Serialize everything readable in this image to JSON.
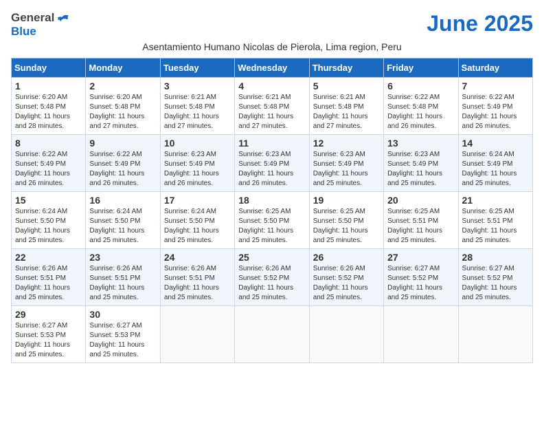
{
  "header": {
    "logo_general": "General",
    "logo_blue": "Blue",
    "month_title": "June 2025",
    "subtitle": "Asentamiento Humano Nicolas de Pierola, Lima region, Peru"
  },
  "weekdays": [
    "Sunday",
    "Monday",
    "Tuesday",
    "Wednesday",
    "Thursday",
    "Friday",
    "Saturday"
  ],
  "weeks": [
    [
      {
        "day": "1",
        "info": "Sunrise: 6:20 AM\nSunset: 5:48 PM\nDaylight: 11 hours\nand 28 minutes."
      },
      {
        "day": "2",
        "info": "Sunrise: 6:20 AM\nSunset: 5:48 PM\nDaylight: 11 hours\nand 27 minutes."
      },
      {
        "day": "3",
        "info": "Sunrise: 6:21 AM\nSunset: 5:48 PM\nDaylight: 11 hours\nand 27 minutes."
      },
      {
        "day": "4",
        "info": "Sunrise: 6:21 AM\nSunset: 5:48 PM\nDaylight: 11 hours\nand 27 minutes."
      },
      {
        "day": "5",
        "info": "Sunrise: 6:21 AM\nSunset: 5:48 PM\nDaylight: 11 hours\nand 27 minutes."
      },
      {
        "day": "6",
        "info": "Sunrise: 6:22 AM\nSunset: 5:48 PM\nDaylight: 11 hours\nand 26 minutes."
      },
      {
        "day": "7",
        "info": "Sunrise: 6:22 AM\nSunset: 5:49 PM\nDaylight: 11 hours\nand 26 minutes."
      }
    ],
    [
      {
        "day": "8",
        "info": "Sunrise: 6:22 AM\nSunset: 5:49 PM\nDaylight: 11 hours\nand 26 minutes."
      },
      {
        "day": "9",
        "info": "Sunrise: 6:22 AM\nSunset: 5:49 PM\nDaylight: 11 hours\nand 26 minutes."
      },
      {
        "day": "10",
        "info": "Sunrise: 6:23 AM\nSunset: 5:49 PM\nDaylight: 11 hours\nand 26 minutes."
      },
      {
        "day": "11",
        "info": "Sunrise: 6:23 AM\nSunset: 5:49 PM\nDaylight: 11 hours\nand 26 minutes."
      },
      {
        "day": "12",
        "info": "Sunrise: 6:23 AM\nSunset: 5:49 PM\nDaylight: 11 hours\nand 25 minutes."
      },
      {
        "day": "13",
        "info": "Sunrise: 6:23 AM\nSunset: 5:49 PM\nDaylight: 11 hours\nand 25 minutes."
      },
      {
        "day": "14",
        "info": "Sunrise: 6:24 AM\nSunset: 5:49 PM\nDaylight: 11 hours\nand 25 minutes."
      }
    ],
    [
      {
        "day": "15",
        "info": "Sunrise: 6:24 AM\nSunset: 5:50 PM\nDaylight: 11 hours\nand 25 minutes."
      },
      {
        "day": "16",
        "info": "Sunrise: 6:24 AM\nSunset: 5:50 PM\nDaylight: 11 hours\nand 25 minutes."
      },
      {
        "day": "17",
        "info": "Sunrise: 6:24 AM\nSunset: 5:50 PM\nDaylight: 11 hours\nand 25 minutes."
      },
      {
        "day": "18",
        "info": "Sunrise: 6:25 AM\nSunset: 5:50 PM\nDaylight: 11 hours\nand 25 minutes."
      },
      {
        "day": "19",
        "info": "Sunrise: 6:25 AM\nSunset: 5:50 PM\nDaylight: 11 hours\nand 25 minutes."
      },
      {
        "day": "20",
        "info": "Sunrise: 6:25 AM\nSunset: 5:51 PM\nDaylight: 11 hours\nand 25 minutes."
      },
      {
        "day": "21",
        "info": "Sunrise: 6:25 AM\nSunset: 5:51 PM\nDaylight: 11 hours\nand 25 minutes."
      }
    ],
    [
      {
        "day": "22",
        "info": "Sunrise: 6:26 AM\nSunset: 5:51 PM\nDaylight: 11 hours\nand 25 minutes."
      },
      {
        "day": "23",
        "info": "Sunrise: 6:26 AM\nSunset: 5:51 PM\nDaylight: 11 hours\nand 25 minutes."
      },
      {
        "day": "24",
        "info": "Sunrise: 6:26 AM\nSunset: 5:51 PM\nDaylight: 11 hours\nand 25 minutes."
      },
      {
        "day": "25",
        "info": "Sunrise: 6:26 AM\nSunset: 5:52 PM\nDaylight: 11 hours\nand 25 minutes."
      },
      {
        "day": "26",
        "info": "Sunrise: 6:26 AM\nSunset: 5:52 PM\nDaylight: 11 hours\nand 25 minutes."
      },
      {
        "day": "27",
        "info": "Sunrise: 6:27 AM\nSunset: 5:52 PM\nDaylight: 11 hours\nand 25 minutes."
      },
      {
        "day": "28",
        "info": "Sunrise: 6:27 AM\nSunset: 5:52 PM\nDaylight: 11 hours\nand 25 minutes."
      }
    ],
    [
      {
        "day": "29",
        "info": "Sunrise: 6:27 AM\nSunset: 5:53 PM\nDaylight: 11 hours\nand 25 minutes."
      },
      {
        "day": "30",
        "info": "Sunrise: 6:27 AM\nSunset: 5:53 PM\nDaylight: 11 hours\nand 25 minutes."
      },
      {
        "day": "",
        "info": ""
      },
      {
        "day": "",
        "info": ""
      },
      {
        "day": "",
        "info": ""
      },
      {
        "day": "",
        "info": ""
      },
      {
        "day": "",
        "info": ""
      }
    ]
  ]
}
